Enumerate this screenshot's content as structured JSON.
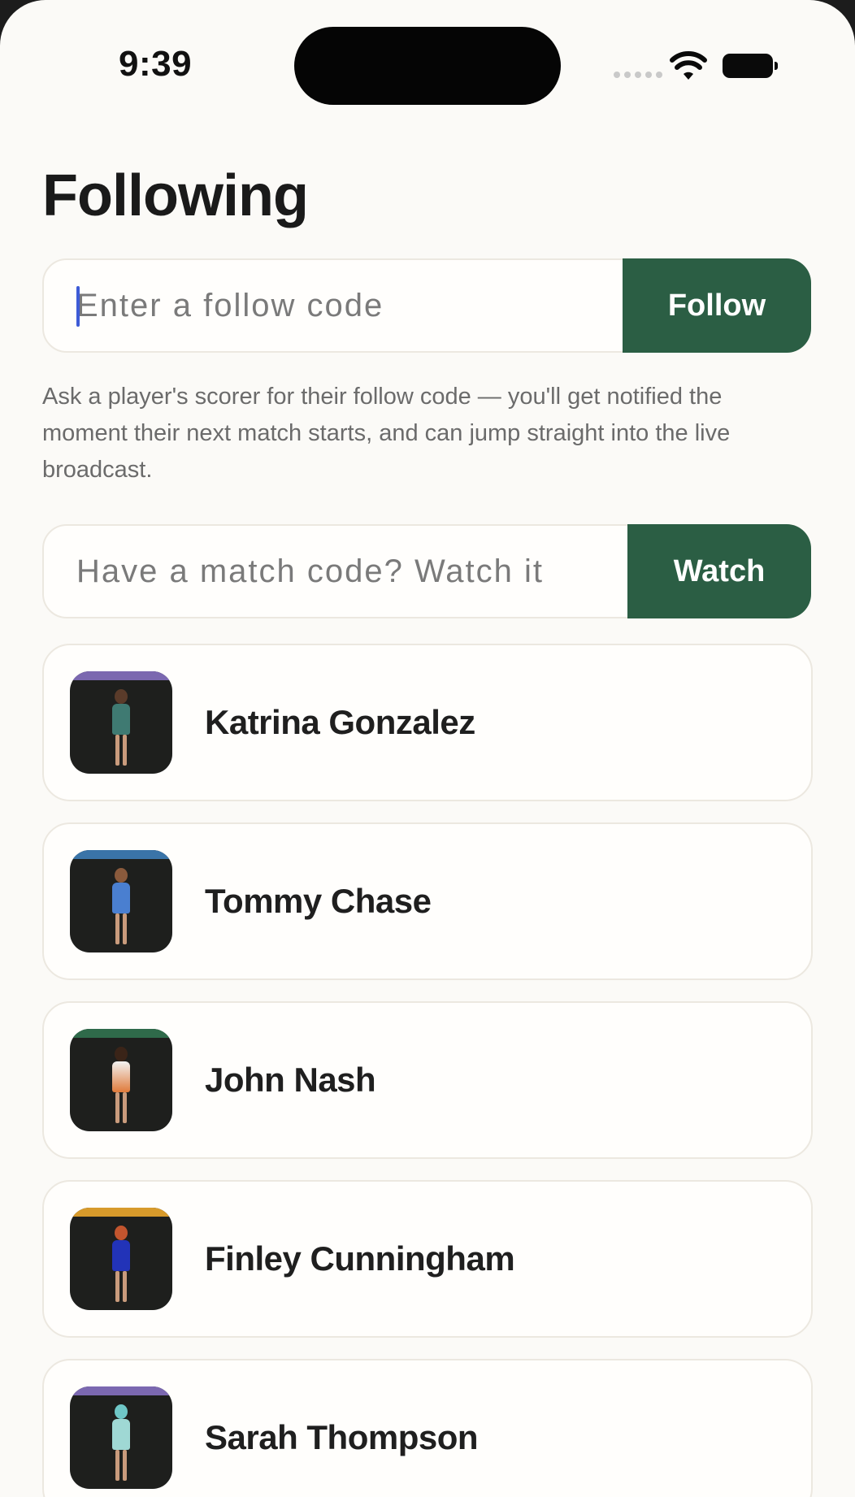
{
  "status_bar": {
    "time": "9:39"
  },
  "page": {
    "title": "Following"
  },
  "follow": {
    "placeholder": "Enter a follow code",
    "button_label": "Follow",
    "help_text": "Ask a player's scorer for their follow code — you'll get notified the moment their next match starts, and can jump straight into the live broadcast."
  },
  "watch": {
    "placeholder": "Have a match code? Watch it",
    "button_label": "Watch"
  },
  "colors": {
    "accent": "#2b5e44",
    "background": "#fbfaf7"
  },
  "players": [
    {
      "name": "Katrina Gonzalez",
      "band_color": "#7b68b0"
    },
    {
      "name": "Tommy Chase",
      "band_color": "#3a74a8"
    },
    {
      "name": "John Nash",
      "band_color": "#2f6a4a"
    },
    {
      "name": "Finley Cunningham",
      "band_color": "#d79a2b"
    },
    {
      "name": "Sarah Thompson",
      "band_color": "#7b68b0"
    }
  ]
}
